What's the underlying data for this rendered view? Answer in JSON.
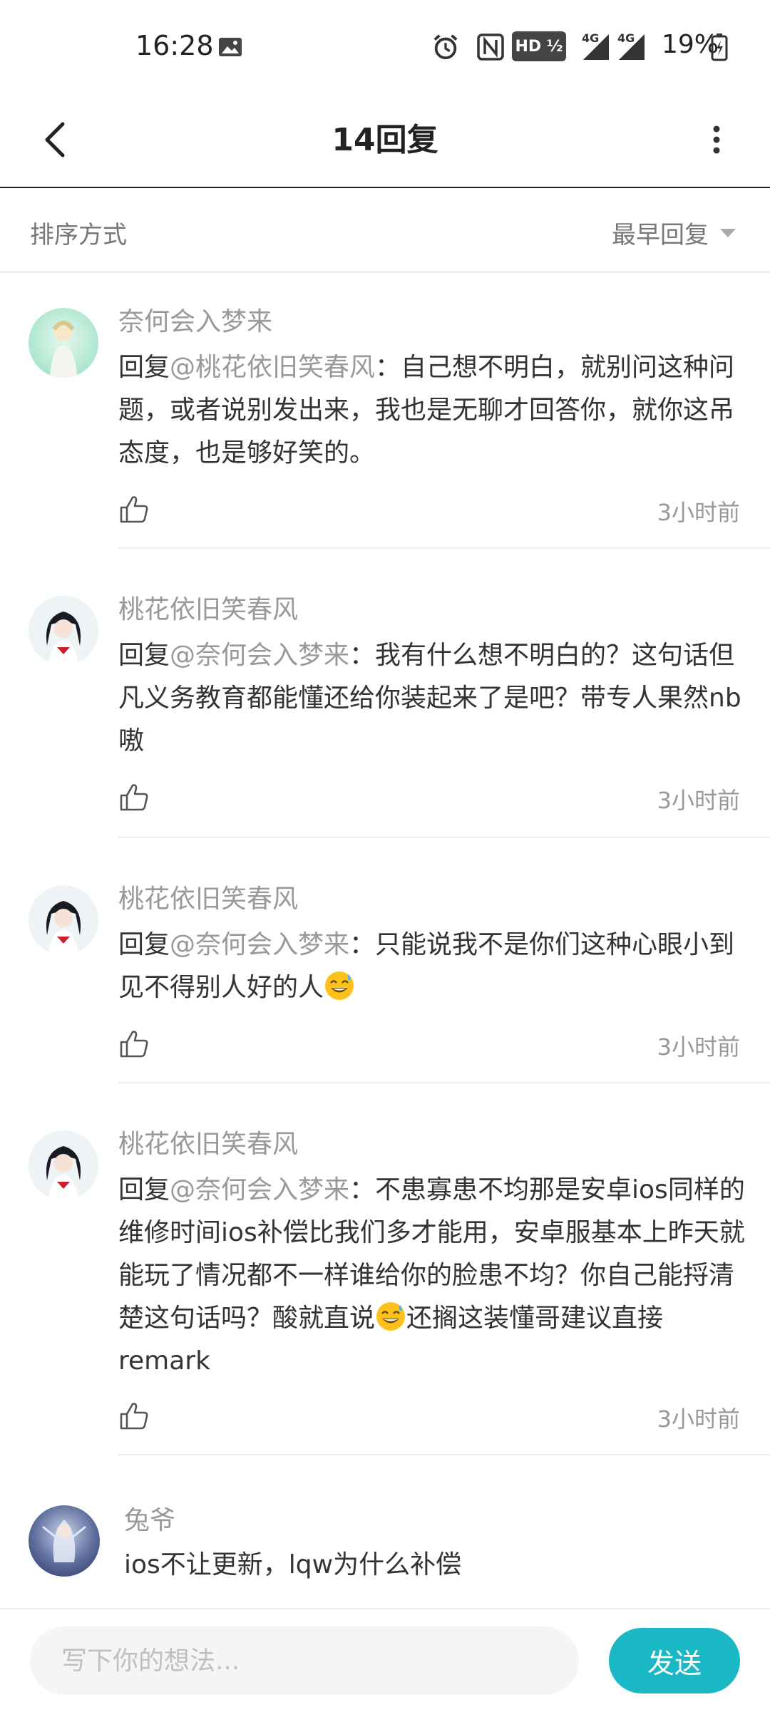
{
  "status_bar": {
    "time": "16:28",
    "network_1": "4G",
    "network_2": "4G",
    "battery": "19%"
  },
  "header": {
    "title": "14回复"
  },
  "sort": {
    "label": "排序方式",
    "selected": "最早回复"
  },
  "comments": [
    {
      "name": "奈何会入梦来",
      "reply_prefix": "回复",
      "mention": "@桃花依旧笑春风",
      "text": "：自己想不明白，就别问这种问题，或者说别发出来，我也是无聊才回答你，就你这吊态度，也是够好笑的。",
      "time": "3小时前"
    },
    {
      "name": "桃花依旧笑春风",
      "reply_prefix": "回复",
      "mention": "@奈何会入梦来",
      "text": "：我有什么想不明白的？这句话但凡义务教育都能懂还给你装起来了是吧？带专人果然nb嗷",
      "time": "3小时前"
    },
    {
      "name": "桃花依旧笑春风",
      "reply_prefix": "回复",
      "mention": "@奈何会入梦来",
      "text": "：只能说我不是你们这种心眼小到见不得别人好的人",
      "time": "3小时前"
    },
    {
      "name": "桃花依旧笑春风",
      "reply_prefix": "回复",
      "mention": "@奈何会入梦来",
      "text_a": "：不患寡患不均那是安卓ios同样的维修时间ios补偿比我们多才能用，安卓服基本上昨天就能玩了情况都不一样谁给你的脸患不均？你自己能捋清楚这句话吗？酸就直说",
      "text_b": "还搁这装懂哥建议直接remark",
      "time": "3小时前"
    },
    {
      "name": "兔爷",
      "text": "ios不让更新，lqw为什么补偿"
    }
  ],
  "composer": {
    "placeholder": "写下你的想法...",
    "send_label": "发送"
  },
  "colors": {
    "accent": "#1ab8c4",
    "muted_text": "#999999",
    "body_text": "#333333"
  }
}
